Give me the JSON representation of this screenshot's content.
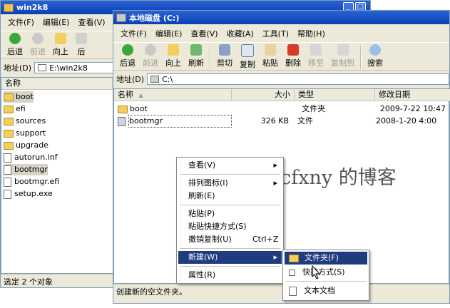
{
  "back_window": {
    "title": "win2k8",
    "menu": [
      "文件(F)",
      "编辑(E)",
      "查看(V)"
    ],
    "toolbar": [
      "后退",
      "前进",
      "向上",
      "后"
    ],
    "address_label": "地址(D)",
    "address_value": "E:\\win2k8",
    "column_name": "名称",
    "items": [
      {
        "name": "boot",
        "kind": "folder"
      },
      {
        "name": "efi",
        "kind": "folder"
      },
      {
        "name": "sources",
        "kind": "folder"
      },
      {
        "name": "support",
        "kind": "folder"
      },
      {
        "name": "upgrade",
        "kind": "folder"
      },
      {
        "name": "autorun.inf",
        "kind": "file"
      },
      {
        "name": "bootmgr",
        "kind": "file"
      },
      {
        "name": "bootmgr.efi",
        "kind": "file"
      },
      {
        "name": "setup.exe",
        "kind": "file"
      }
    ],
    "status": "选定 2 个对象"
  },
  "front_window": {
    "title": "本地磁盘 (C:)",
    "menu": [
      "文件(F)",
      "编辑(E)",
      "查看(V)",
      "收藏(A)",
      "工具(T)",
      "帮助(H)"
    ],
    "toolbar": [
      "后退",
      "前进",
      "向上",
      "刷新",
      "剪切",
      "复制",
      "粘贴",
      "删除",
      "移至",
      "复制到",
      "搜索"
    ],
    "address_label": "地址(D)",
    "address_value": "C:\\",
    "columns": {
      "name": "名称",
      "size": "大小",
      "type": "类型",
      "modified": "修改日期"
    },
    "rows": [
      {
        "name": "boot",
        "size": "",
        "type": "文件夹",
        "modified": "2009-7-22 10:47",
        "kind": "folder"
      },
      {
        "name": "bootmgr",
        "size": "326 KB",
        "type": "文件",
        "modified": "2008-1-20 4:00",
        "kind": "file"
      }
    ],
    "status": "创建新的空文件夹。"
  },
  "context_menu": {
    "view": "查看(V)",
    "arrange": "排列图标(I)",
    "refresh": "刷新(E)",
    "paste": "粘贴(P)",
    "paste_shortcut": "粘贴快捷方式(S)",
    "undo_copy": "撤销复制(U)",
    "undo_shortcut": "Ctrl+Z",
    "new": "新建(W)",
    "properties": "属性(R)"
  },
  "submenu": {
    "folder": "文件夹(F)",
    "shortcut": "快捷方式(S)",
    "text_doc": "文本文档"
  },
  "watermark": "ccfxny 的博客",
  "colors": {
    "title_blue": "#0b3fb4",
    "highlight": "#1f3c7f",
    "folder": "#f2cf5b"
  }
}
